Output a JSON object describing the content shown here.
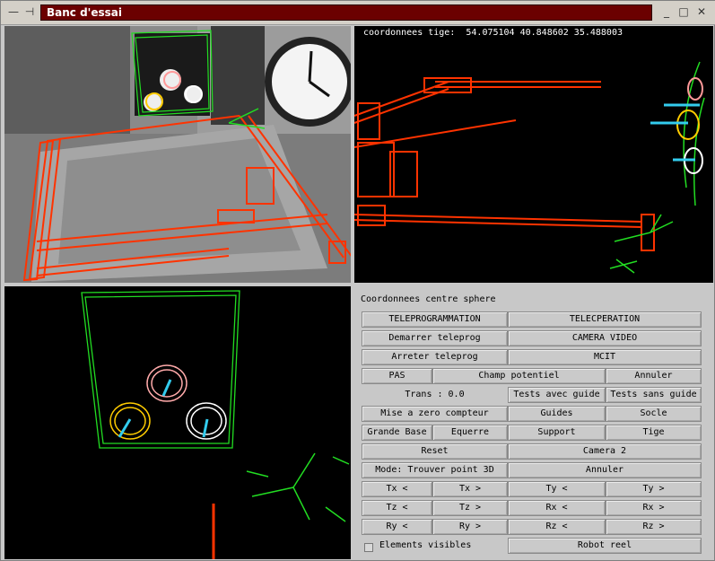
{
  "window": {
    "title": "Banc d'essai",
    "minimize_glyph": "—",
    "pin_glyph": "⊣",
    "minimize_right_glyph": "_",
    "maximize_glyph": "□",
    "close_glyph": "✕"
  },
  "views": {
    "coords_readout": "coordonnees tige:  54.075104 40.848602 35.488003"
  },
  "panel": {
    "title": "Coordonnees centre sphere",
    "teleprog": "TELEPROGRAMMATION",
    "teleop": "TELECPERATION",
    "start_teleprog": "Demarrer teleprog",
    "camera_video": "CAMERA VIDEO",
    "stop_teleprog": "Arreter teleprog",
    "mcit": "MCIT",
    "pas": "PAS",
    "champ": "Champ potentiel",
    "annuler1": "Annuler",
    "trans": "Trans : 0.0",
    "tests_avec": "Tests avec guide",
    "tests_sans": "Tests sans guide",
    "reset_compteur": "Mise a zero compteur",
    "guides": "Guides",
    "socle": "Socle",
    "grande_base": "Grande Base",
    "equerre": "Equerre",
    "support": "Support",
    "tige": "Tige",
    "reset": "Reset",
    "camera2": "Camera 2",
    "mode": "Mode: Trouver point 3D",
    "annuler2": "Annuler",
    "tx_minus": "Tx <",
    "tx_plus": "Tx >",
    "ty_minus": "Ty <",
    "ty_plus": "Ty >",
    "tz_minus": "Tz <",
    "tz_plus": "Tz >",
    "rx_minus": "Rx <",
    "rx_plus": "Rx >",
    "ry_minus": "Ry <",
    "ry_plus": "Ry >",
    "rz_minus": "Rz <",
    "rz_plus": "Rz >",
    "elements_visibles": "Elements visibles",
    "robot_reel": "Robot reel"
  },
  "colors": {
    "robot": "#ff3300",
    "frame": "#22dd22",
    "cursor": "#33ccee"
  }
}
